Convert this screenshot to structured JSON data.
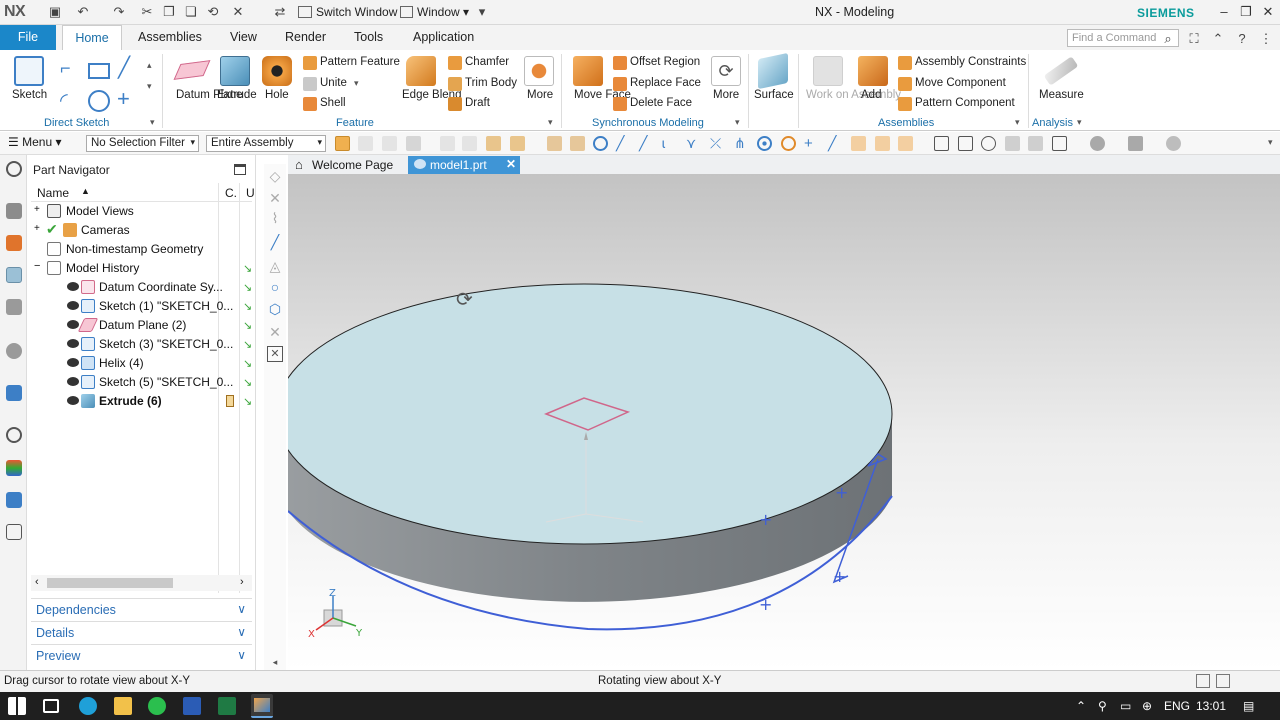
{
  "app": {
    "logo": "NX",
    "title": "NX - Modeling",
    "brand": "SIEMENS"
  },
  "titlebar": {
    "switch_window": "Switch Window",
    "window": "Window"
  },
  "ribbon_tabs": [
    "File",
    "Home",
    "Assemblies",
    "View",
    "Render",
    "Tools",
    "Application"
  ],
  "search": {
    "placeholder": "Find a Command"
  },
  "ribbon": {
    "direct_sketch": {
      "sketch": "Sketch",
      "group": "Direct Sketch"
    },
    "feature": {
      "datum_plane": "Datum Plane",
      "extrude": "Extrude",
      "hole": "Hole",
      "pattern_feature": "Pattern Feature",
      "unite": "Unite",
      "shell": "Shell",
      "edge_blend": "Edge Blend",
      "chamfer": "Chamfer",
      "trim_body": "Trim Body",
      "draft": "Draft",
      "more": "More",
      "group": "Feature"
    },
    "synchronous": {
      "move_face": "Move Face",
      "offset_region": "Offset Region",
      "replace_face": "Replace Face",
      "delete_face": "Delete Face",
      "more": "More",
      "group": "Synchronous Modeling"
    },
    "surface": {
      "surface": "Surface"
    },
    "assemblies": {
      "work_on_assembly": "Work on Assembly",
      "add": "Add",
      "assembly_constraints": "Assembly Constraints",
      "move_component": "Move Component",
      "pattern_component": "Pattern Component",
      "group": "Assemblies"
    },
    "analysis": {
      "measure": "Measure",
      "group": "Analysis"
    }
  },
  "selection_bar": {
    "menu": "Menu",
    "filter": "No Selection Filter",
    "scope": "Entire Assembly"
  },
  "navigator": {
    "title": "Part Navigator",
    "col_name": "Name",
    "col_c": "C.",
    "col_u": "U",
    "rows": [
      {
        "label": "Model Views",
        "indent": 0
      },
      {
        "label": "Cameras",
        "indent": 0
      },
      {
        "label": "Non-timestamp Geometry",
        "indent": 0
      },
      {
        "label": "Model History",
        "indent": 0
      },
      {
        "label": "Datum Coordinate Sy...",
        "indent": 1
      },
      {
        "label": "Sketch (1) \"SKETCH_0...",
        "indent": 1
      },
      {
        "label": "Datum Plane (2)",
        "indent": 1
      },
      {
        "label": "Sketch (3) \"SKETCH_0...",
        "indent": 1
      },
      {
        "label": "Helix (4)",
        "indent": 1
      },
      {
        "label": "Sketch (5) \"SKETCH_0...",
        "indent": 1
      },
      {
        "label": "Extrude (6)",
        "indent": 1
      }
    ],
    "panels": [
      "Dependencies",
      "Details",
      "Preview"
    ]
  },
  "doc_tabs": [
    "Welcome Page",
    "model1.prt"
  ],
  "status": {
    "left": "Drag cursor to rotate view about X-Y",
    "center": "Rotating view about X-Y"
  },
  "taskbar": {
    "lang": "ENG",
    "time": "13:01"
  },
  "axes": {
    "x": "X",
    "y": "Y",
    "z": "Z"
  },
  "colors": {
    "accent": "#1b87c9",
    "model_top": "#c7e0e6",
    "model_side": "#8a8f93",
    "edge_highlight": "#3f5fd6"
  }
}
